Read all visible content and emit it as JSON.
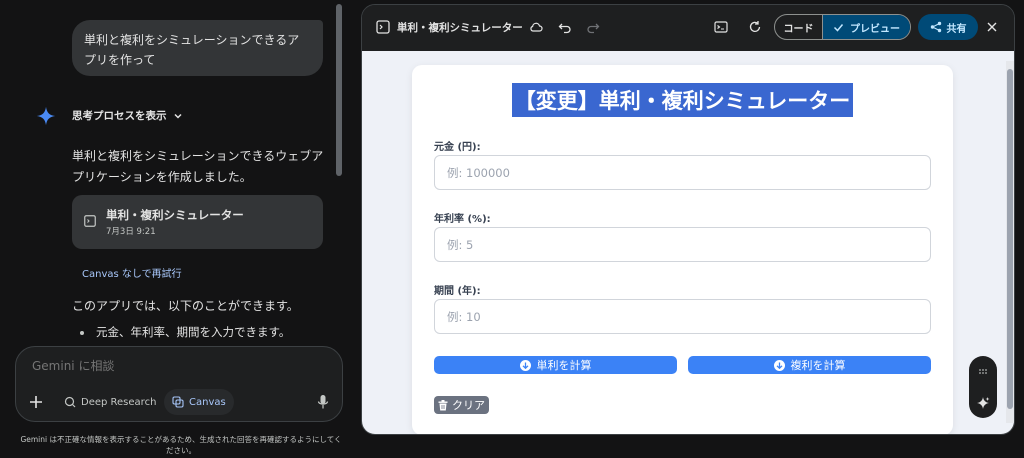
{
  "chat": {
    "user_message": "単利と複利をシミュレーションできるアプリを作って",
    "thinking_label": "思考プロセスを表示",
    "answer_text": "単利と複利をシミュレーションできるウェブアプリケーションを作成しました。",
    "card": {
      "title": "単利・複利シミュレーター",
      "date": "7月3日 9:21"
    },
    "retry_link": "Canvas なしで再試行",
    "intro_text": "このアプリでは、以下のことができます。",
    "bullet_1": "元金、年利率、期間を入力できます。"
  },
  "input": {
    "placeholder": "Gemini に相談",
    "deep_research_label": "Deep Research",
    "canvas_label": "Canvas"
  },
  "disclaimer": "Gemini は不正確な情報を表示することがあるため、生成された回答を再確認するようにしてください。",
  "canvas": {
    "title": "単利・複利シミュレーター",
    "code_label": "コード",
    "preview_label": "プレビュー",
    "share_label": "共有"
  },
  "app": {
    "heading": "【変更】単利・複利シミュレーター",
    "principal_label": "元金 (円):",
    "principal_placeholder": "例: 100000",
    "rate_label": "年利率 (%):",
    "rate_placeholder": "例: 5",
    "period_label": "期間 (年):",
    "period_placeholder": "例: 10",
    "simple_button": "単利を計算",
    "compound_button": "複利を計算",
    "clear_button": "クリア"
  },
  "colors": {
    "accent_button": "#3b82f6",
    "heading_highlight": "#3a67d0",
    "preview_toggle": "#004a77"
  }
}
